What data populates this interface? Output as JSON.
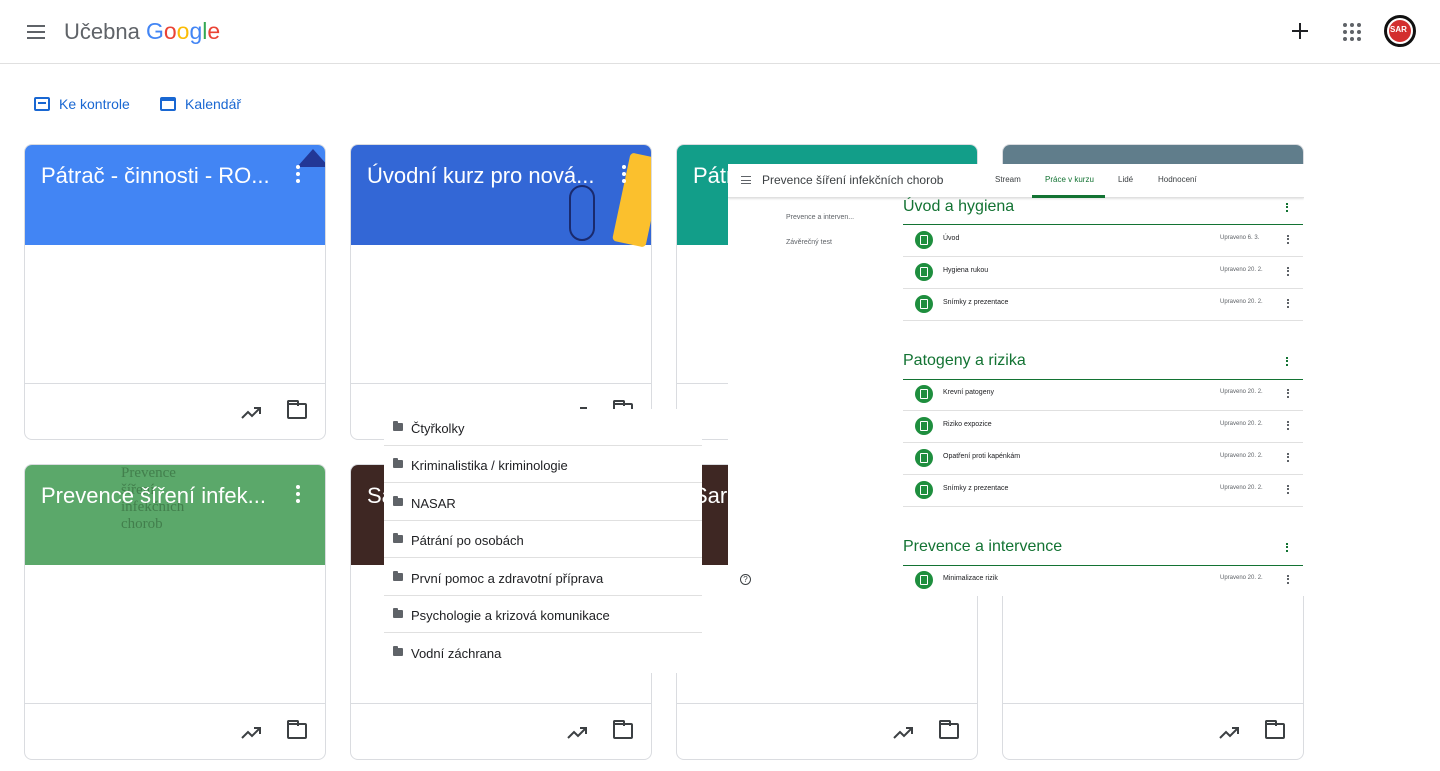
{
  "app": {
    "title_prefix": "Učebna",
    "title_brand": "Google"
  },
  "header": {
    "add_icon": "plus-icon",
    "apps_icon": "apps-grid-icon",
    "avatar_text": "SAR"
  },
  "subnav": {
    "to_review": "Ke kontrole",
    "calendar": "Kalendář"
  },
  "colors": {
    "brand_blue": "#1967d2",
    "google_green": "#137333",
    "card_blue": "#4285f4",
    "card_indigo": "#3367d6",
    "card_teal": "#129e89",
    "card_slate": "#607d8b",
    "card_green": "#5ba86a",
    "card_brown": "#3e2723"
  },
  "cards": [
    {
      "title": "Pátrač - činnosti - RO..."
    },
    {
      "title": "Úvodní kurz pro nová..."
    },
    {
      "title": "Pátr"
    },
    {
      "title": ""
    },
    {
      "title": "Prevence šíření infek..."
    },
    {
      "title": "Sa"
    },
    {
      "title": "Sar"
    },
    {
      "title": ""
    }
  ],
  "card4_overlay_text": [
    "Prevence",
    "šíření",
    "infekčních",
    "chorob"
  ],
  "dropdown": {
    "items": [
      "Čtyřkolky",
      "Kriminalistika / kriminologie",
      "NASAR",
      "Pátrání po osobách",
      "První pomoc a zdravotní příprava",
      "Psychologie a krizová komunikace",
      "Vodní záchrana"
    ]
  },
  "course_preview": {
    "course_title": "Prevence šíření infekčních chorob",
    "tabs": [
      "Stream",
      "Práce v kurzu",
      "Lidé",
      "Hodnocení"
    ],
    "active_tab": "Práce v kurzu",
    "side_links": [
      "Prevence a interven...",
      "Závěrečný test"
    ],
    "topics": [
      {
        "title": "Úvod a hygiena",
        "materials": [
          {
            "name": "Úvod",
            "date": "Upraveno 6. 3."
          },
          {
            "name": "Hygiena rukou",
            "date": "Upraveno 20. 2."
          },
          {
            "name": "Snímky z prezentace",
            "date": "Upraveno 20. 2."
          }
        ]
      },
      {
        "title": "Patogeny a rizika",
        "materials": [
          {
            "name": "Krevní patogeny",
            "date": "Upraveno 20. 2."
          },
          {
            "name": "Riziko expozice",
            "date": "Upraveno 20. 2."
          },
          {
            "name": "Opatření proti kapénkám",
            "date": "Upraveno 20. 2."
          },
          {
            "name": "Snímky z prezentace",
            "date": "Upraveno 20. 2."
          }
        ]
      },
      {
        "title": "Prevence a intervence",
        "materials": [
          {
            "name": "Minimalizace rizik",
            "date": "Upraveno 20. 2."
          }
        ]
      }
    ]
  }
}
